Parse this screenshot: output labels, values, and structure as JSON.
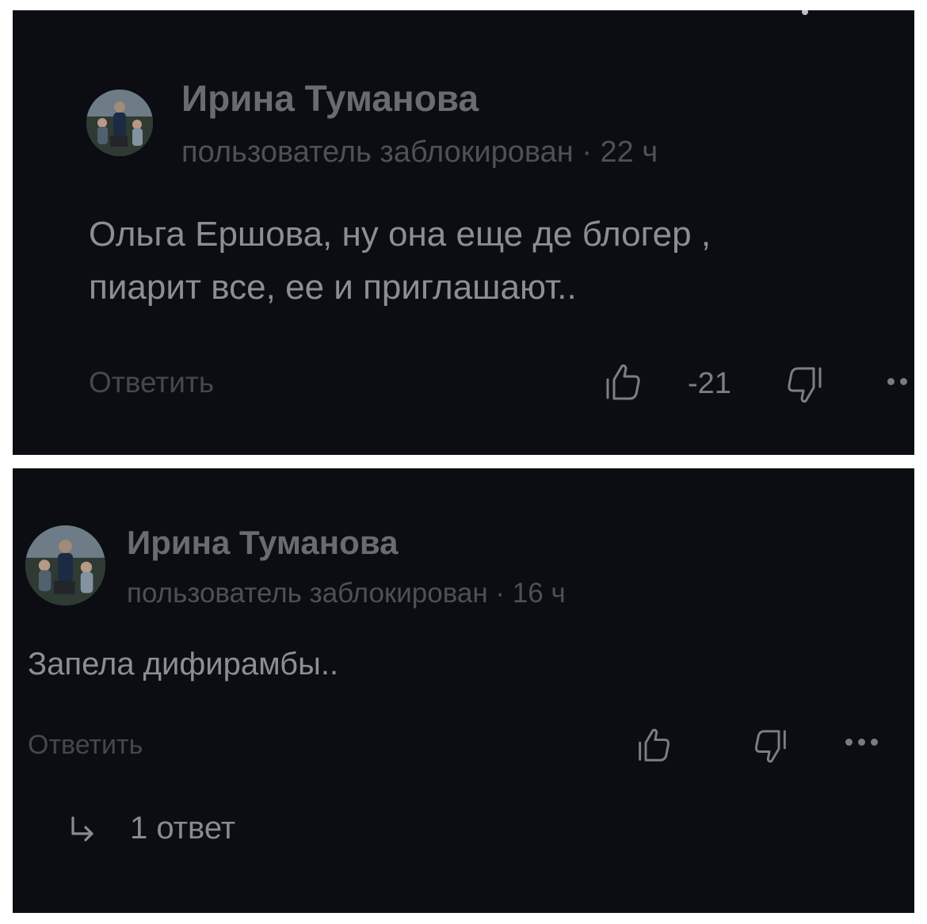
{
  "comments": [
    {
      "author": "Ирина Туманова",
      "meta": "пользователь заблокирован · 22 ч",
      "text_line1": "Ольга Ершова, ну она еще де блогер ,",
      "text_line2": "пиарит все, ее и приглашают..",
      "reply_label": "Ответить",
      "rating": "-21"
    },
    {
      "author": "Ирина Туманова",
      "meta": "пользователь заблокирован · 16 ч",
      "text": "Запела дифирамбы..",
      "reply_label": "Ответить",
      "replies_label": "1 ответ"
    }
  ],
  "icons": {
    "like": "thumbs-up-icon",
    "dislike": "thumbs-down-icon",
    "more": "more-dots-icon",
    "replies": "reply-arrow-icon"
  },
  "colors": {
    "background": "#0c0d12",
    "author": "#6a6b70",
    "meta": "#4f5055",
    "text": "#8d8e92"
  }
}
